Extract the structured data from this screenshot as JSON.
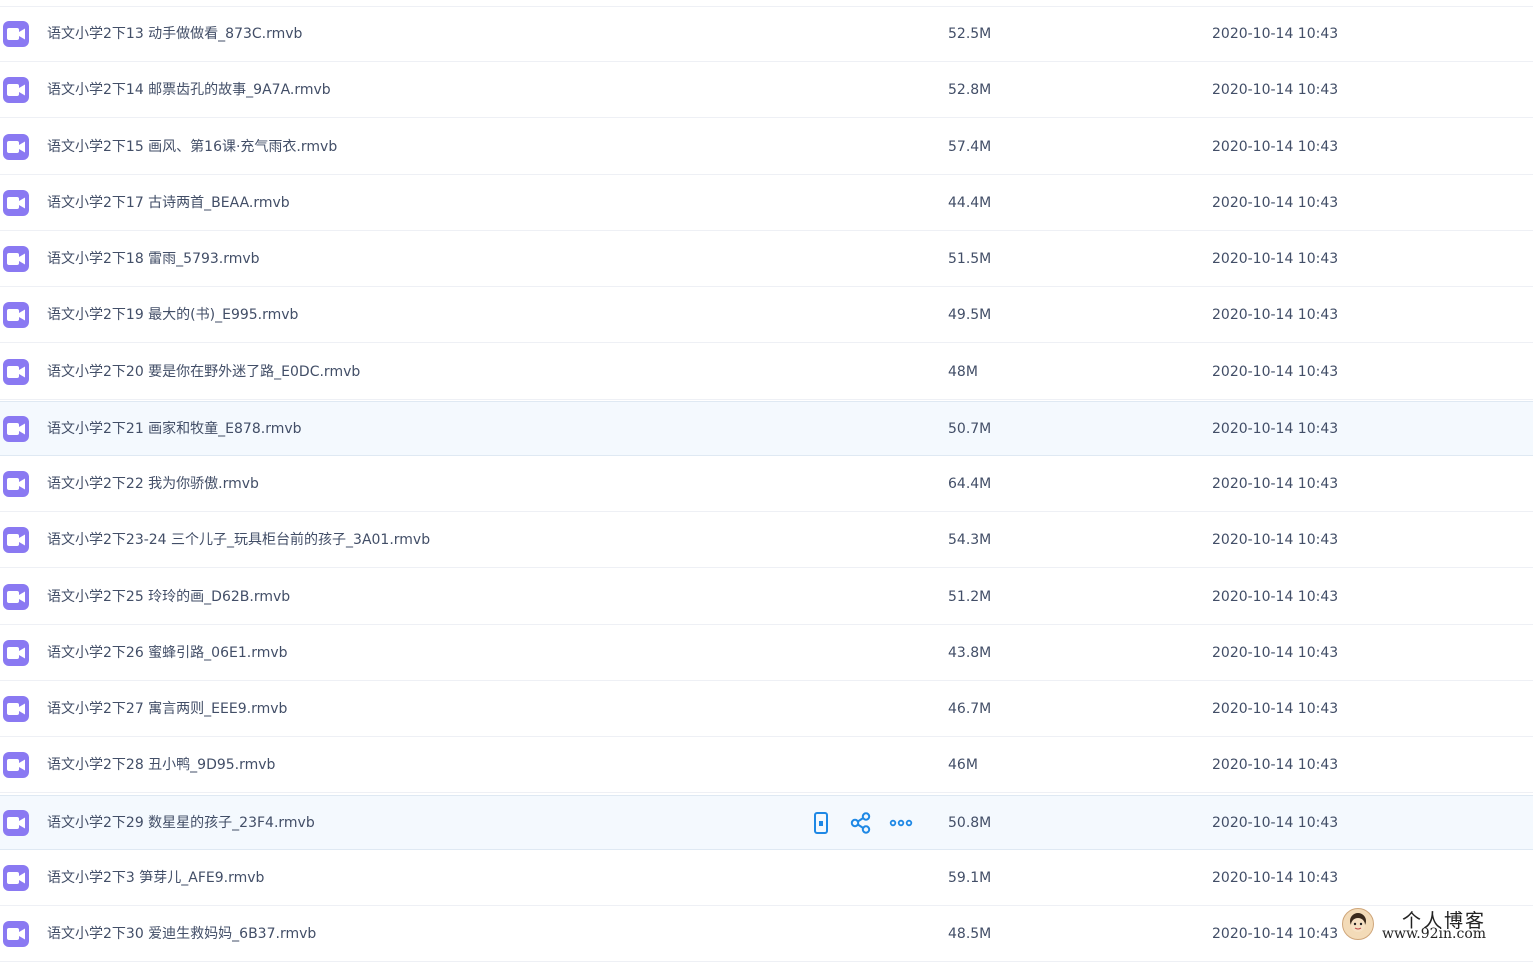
{
  "files": [
    {
      "name": "语文小学2下13 动手做做看_873C.rmvb",
      "size": "52.5M",
      "modified": "2020-10-14 10:43"
    },
    {
      "name": "语文小学2下14 邮票齿孔的故事_9A7A.rmvb",
      "size": "52.8M",
      "modified": "2020-10-14 10:43"
    },
    {
      "name": "语文小学2下15 画风、第16课·充气雨衣.rmvb",
      "size": "57.4M",
      "modified": "2020-10-14 10:43"
    },
    {
      "name": "语文小学2下17 古诗两首_BEAA.rmvb",
      "size": "44.4M",
      "modified": "2020-10-14 10:43"
    },
    {
      "name": "语文小学2下18 雷雨_5793.rmvb",
      "size": "51.5M",
      "modified": "2020-10-14 10:43"
    },
    {
      "name": "语文小学2下19 最大的(书)_E995.rmvb",
      "size": "49.5M",
      "modified": "2020-10-14 10:43"
    },
    {
      "name": "语文小学2下20 要是你在野外迷了路_E0DC.rmvb",
      "size": "48M",
      "modified": "2020-10-14 10:43"
    },
    {
      "name": "语文小学2下21 画家和牧童_E878.rmvb",
      "size": "50.7M",
      "modified": "2020-10-14 10:43"
    },
    {
      "name": "语文小学2下22 我为你骄傲.rmvb",
      "size": "64.4M",
      "modified": "2020-10-14 10:43"
    },
    {
      "name": "语文小学2下23-24 三个儿子_玩具柜台前的孩子_3A01.rmvb",
      "size": "54.3M",
      "modified": "2020-10-14 10:43"
    },
    {
      "name": "语文小学2下25 玲玲的画_D62B.rmvb",
      "size": "51.2M",
      "modified": "2020-10-14 10:43"
    },
    {
      "name": "语文小学2下26 蜜蜂引路_06E1.rmvb",
      "size": "43.8M",
      "modified": "2020-10-14 10:43"
    },
    {
      "name": "语文小学2下27 寓言两则_EEE9.rmvb",
      "size": "46.7M",
      "modified": "2020-10-14 10:43"
    },
    {
      "name": "语文小学2下28 丑小鸭_9D95.rmvb",
      "size": "46M",
      "modified": "2020-10-14 10:43"
    },
    {
      "name": "语文小学2下29 数星星的孩子_23F4.rmvb",
      "size": "50.8M",
      "modified": "2020-10-14 10:43"
    },
    {
      "name": "语文小学2下3 笋芽儿_AFE9.rmvb",
      "size": "59.1M",
      "modified": "2020-10-14 10:43"
    },
    {
      "name": "语文小学2下30 爱迪生救妈妈_6B37.rmvb",
      "size": "48.5M",
      "modified": "2020-10-14 10:43"
    }
  ],
  "highlighted_rows": [
    7,
    14
  ],
  "hover_row": 14,
  "row_actions": [
    {
      "icon": "phone-icon"
    },
    {
      "icon": "share-icon"
    },
    {
      "icon": "more-icon"
    }
  ],
  "file_icon": "video-file-icon",
  "colors": {
    "file_icon_bg": "#8a79f2",
    "action_icon": "#1e88e5",
    "text": "#424e67",
    "row_highlight": "#f4f9fe"
  },
  "watermark": {
    "title": "个人博客",
    "url": "www.92in.com"
  }
}
